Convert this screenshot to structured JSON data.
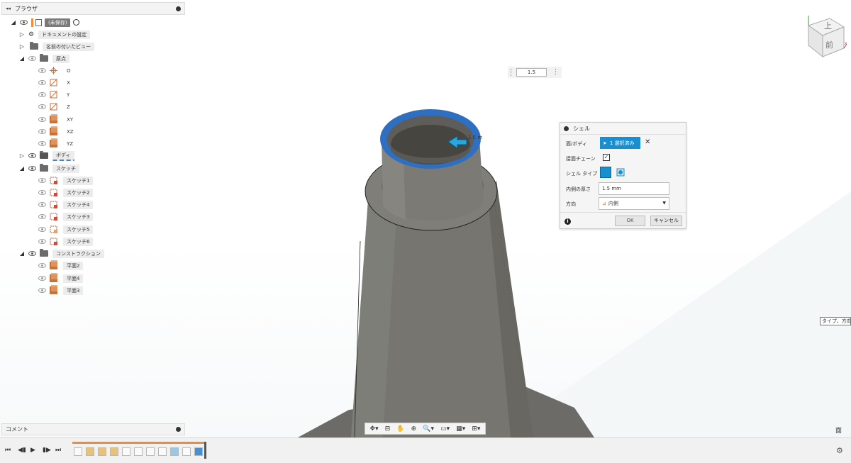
{
  "browser": {
    "title": "ブラウザ",
    "items": [
      {
        "label": "(未保存)"
      },
      {
        "label": "ドキュメントの設定"
      },
      {
        "label": "名前の付いたビュー"
      },
      {
        "label": "原点"
      },
      {
        "label": "O"
      },
      {
        "label": "X"
      },
      {
        "label": "Y"
      },
      {
        "label": "Z"
      },
      {
        "label": "XY"
      },
      {
        "label": "XZ"
      },
      {
        "label": "YZ"
      },
      {
        "label": "ボディ"
      },
      {
        "label": "スケッチ"
      },
      {
        "label": "スケッチ1"
      },
      {
        "label": "スケッチ2"
      },
      {
        "label": "スケッチ4"
      },
      {
        "label": "スケッチ3"
      },
      {
        "label": "スケッチ5"
      },
      {
        "label": "スケッチ6"
      },
      {
        "label": "コンストラクション"
      },
      {
        "label": "平面2"
      },
      {
        "label": "平面4"
      },
      {
        "label": "平面3"
      }
    ]
  },
  "comment": {
    "title": "コメント"
  },
  "viewcube": {
    "top": "上",
    "front": "前"
  },
  "dimension": {
    "value": "1.5",
    "canvas_label": "1.5 m"
  },
  "shell": {
    "title": "シェル",
    "faces_label": "面/ボディ",
    "selected": "1 選択済み",
    "tangent_label": "接面チェーン",
    "tangent_checked": "✓",
    "type_label": "シェル タイプ",
    "thickness_label": "内側の厚さ",
    "thickness_value": "1.5 mm",
    "direction_label": "方向",
    "direction_value": "内側",
    "ok": "OK",
    "cancel": "キャンセル",
    "info": "i"
  },
  "tooltip": "タイプ、方向",
  "corner_label": "面",
  "colors": {
    "accent": "#1a8fd0",
    "timeline": "#f08a3c",
    "body": "#6e6d69",
    "face_highlight": "#2f6fc2"
  },
  "nav_icons": [
    "orbit-icon",
    "fit-icon",
    "pan-icon",
    "zoom-window-icon",
    "zoom-icon",
    "display-icon",
    "grid-icon",
    "viewports-icon"
  ],
  "timeline_features": 11
}
